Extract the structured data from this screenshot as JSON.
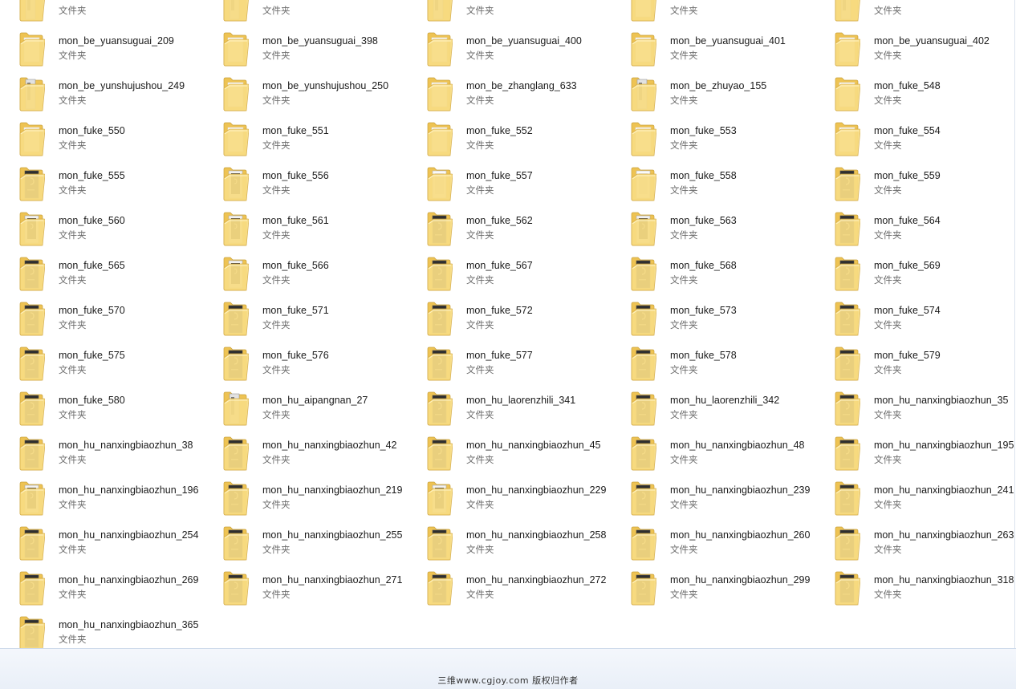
{
  "folder_type_label": "文件夹",
  "colors": {
    "folder_yellow": "#f6d67a",
    "folder_dark": "#f0c24e",
    "thumb_dark": "#2e2e2e",
    "details_bg": "#eef3fa"
  },
  "items": [
    {
      "name": "",
      "thumb": "tall"
    },
    {
      "name": "",
      "thumb": "tall"
    },
    {
      "name": "",
      "thumb": "tall"
    },
    {
      "name": "",
      "thumb": "plain"
    },
    {
      "name": "",
      "thumb": "tall"
    },
    {
      "name": "mon_be_yuansuguai_209",
      "thumb": "plain"
    },
    {
      "name": "mon_be_yuansuguai_398",
      "thumb": "plain"
    },
    {
      "name": "mon_be_yuansuguai_400",
      "thumb": "plain"
    },
    {
      "name": "mon_be_yuansuguai_401",
      "thumb": "plain"
    },
    {
      "name": "mon_be_yuansuguai_402",
      "thumb": "plain"
    },
    {
      "name": "mon_be_yunshujushou_249",
      "thumb": "tall"
    },
    {
      "name": "mon_be_yunshujushou_250",
      "thumb": "plain"
    },
    {
      "name": "mon_be_zhanglang_633",
      "thumb": "plain"
    },
    {
      "name": "mon_be_zhuyao_155",
      "thumb": "tall"
    },
    {
      "name": "mon_fuke_548",
      "thumb": "plain"
    },
    {
      "name": "mon_fuke_550",
      "thumb": "plain"
    },
    {
      "name": "mon_fuke_551",
      "thumb": "plain"
    },
    {
      "name": "mon_fuke_552",
      "thumb": "plain"
    },
    {
      "name": "mon_fuke_553",
      "thumb": "plain"
    },
    {
      "name": "mon_fuke_554",
      "thumb": "plain"
    },
    {
      "name": "mon_fuke_555",
      "thumb": "dark"
    },
    {
      "name": "mon_fuke_556",
      "thumb": "light"
    },
    {
      "name": "mon_fuke_557",
      "thumb": "white"
    },
    {
      "name": "mon_fuke_558",
      "thumb": "white"
    },
    {
      "name": "mon_fuke_559",
      "thumb": "dark"
    },
    {
      "name": "mon_fuke_560",
      "thumb": "light"
    },
    {
      "name": "mon_fuke_561",
      "thumb": "light"
    },
    {
      "name": "mon_fuke_562",
      "thumb": "dark"
    },
    {
      "name": "mon_fuke_563",
      "thumb": "light"
    },
    {
      "name": "mon_fuke_564",
      "thumb": "dark"
    },
    {
      "name": "mon_fuke_565",
      "thumb": "dark"
    },
    {
      "name": "mon_fuke_566",
      "thumb": "light"
    },
    {
      "name": "mon_fuke_567",
      "thumb": "dark"
    },
    {
      "name": "mon_fuke_568",
      "thumb": "dark"
    },
    {
      "name": "mon_fuke_569",
      "thumb": "dark"
    },
    {
      "name": "mon_fuke_570",
      "thumb": "dark"
    },
    {
      "name": "mon_fuke_571",
      "thumb": "dark"
    },
    {
      "name": "mon_fuke_572",
      "thumb": "dark"
    },
    {
      "name": "mon_fuke_573",
      "thumb": "dark"
    },
    {
      "name": "mon_fuke_574",
      "thumb": "dark"
    },
    {
      "name": "mon_fuke_575",
      "thumb": "dark"
    },
    {
      "name": "mon_fuke_576",
      "thumb": "dark"
    },
    {
      "name": "mon_fuke_577",
      "thumb": "dark"
    },
    {
      "name": "mon_fuke_578",
      "thumb": "dark"
    },
    {
      "name": "mon_fuke_579",
      "thumb": "dark"
    },
    {
      "name": "mon_fuke_580",
      "thumb": "dark"
    },
    {
      "name": "mon_hu_aipangnan_27",
      "thumb": "tall"
    },
    {
      "name": "mon_hu_laorenzhili_341",
      "thumb": "dark"
    },
    {
      "name": "mon_hu_laorenzhili_342",
      "thumb": "dark"
    },
    {
      "name": "mon_hu_nanxingbiaozhun_35",
      "thumb": "dark"
    },
    {
      "name": "mon_hu_nanxingbiaozhun_38",
      "thumb": "dark"
    },
    {
      "name": "mon_hu_nanxingbiaozhun_42",
      "thumb": "dark"
    },
    {
      "name": "mon_hu_nanxingbiaozhun_45",
      "thumb": "dark"
    },
    {
      "name": "mon_hu_nanxingbiaozhun_48",
      "thumb": "dark"
    },
    {
      "name": "mon_hu_nanxingbiaozhun_195",
      "thumb": "dark"
    },
    {
      "name": "mon_hu_nanxingbiaozhun_196",
      "thumb": "light"
    },
    {
      "name": "mon_hu_nanxingbiaozhun_219",
      "thumb": "dark"
    },
    {
      "name": "mon_hu_nanxingbiaozhun_229",
      "thumb": "light"
    },
    {
      "name": "mon_hu_nanxingbiaozhun_239",
      "thumb": "dark"
    },
    {
      "name": "mon_hu_nanxingbiaozhun_241",
      "thumb": "dark"
    },
    {
      "name": "mon_hu_nanxingbiaozhun_254",
      "thumb": "dark"
    },
    {
      "name": "mon_hu_nanxingbiaozhun_255",
      "thumb": "dark"
    },
    {
      "name": "mon_hu_nanxingbiaozhun_258",
      "thumb": "dark"
    },
    {
      "name": "mon_hu_nanxingbiaozhun_260",
      "thumb": "dark"
    },
    {
      "name": "mon_hu_nanxingbiaozhun_263",
      "thumb": "dark"
    },
    {
      "name": "mon_hu_nanxingbiaozhun_269",
      "thumb": "dark"
    },
    {
      "name": "mon_hu_nanxingbiaozhun_271",
      "thumb": "dark"
    },
    {
      "name": "mon_hu_nanxingbiaozhun_272",
      "thumb": "dark"
    },
    {
      "name": "mon_hu_nanxingbiaozhun_299",
      "thumb": "dark"
    },
    {
      "name": "mon_hu_nanxingbiaozhun_318",
      "thumb": "dark"
    },
    {
      "name": "mon_hu_nanxingbiaozhun_365",
      "thumb": "dark"
    }
  ],
  "details_pane": {
    "watermark": "三维www.cgjoy.com 版权归作者"
  }
}
